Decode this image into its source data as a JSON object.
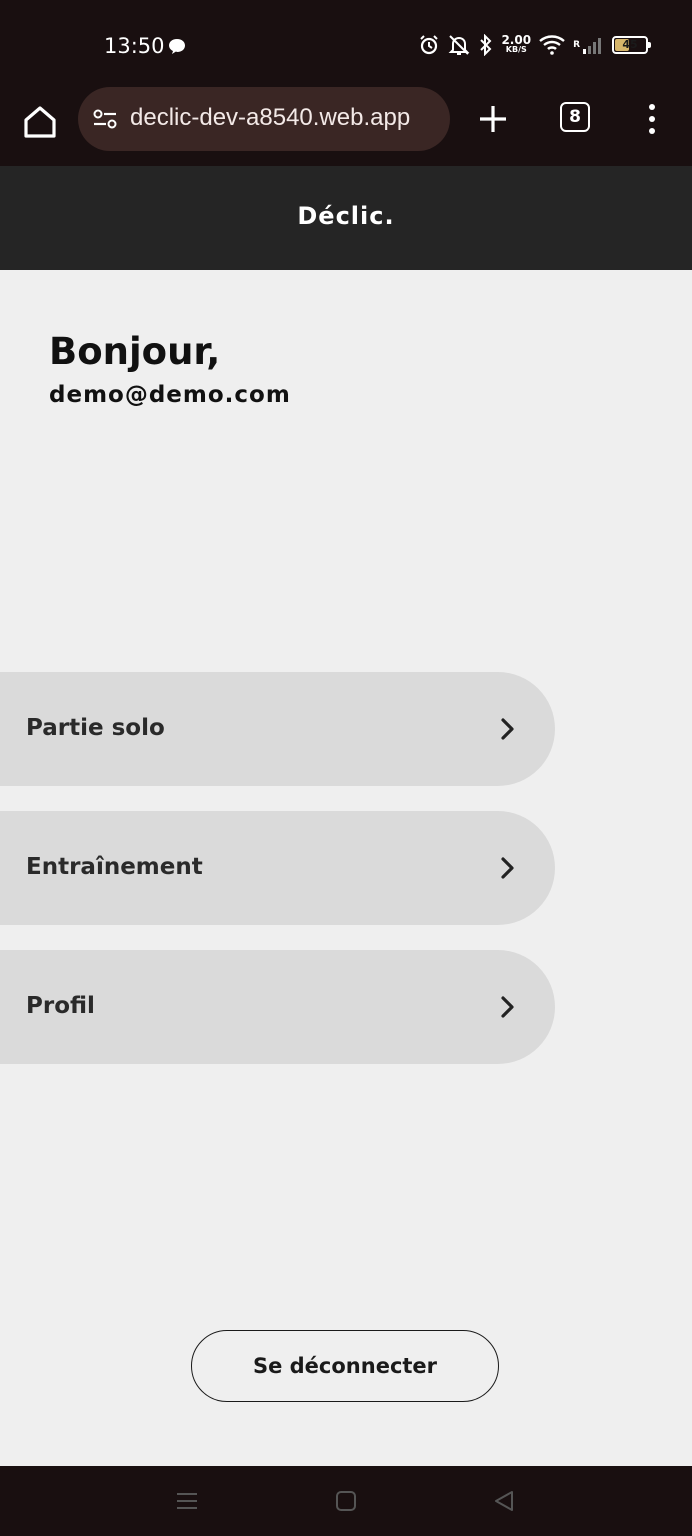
{
  "status_bar": {
    "time": "13:50",
    "network_speed_value": "2.00",
    "network_speed_unit": "KB/S",
    "signal_label": "R",
    "battery_level": "45",
    "icons": [
      "chat-bubble-icon",
      "alarm-icon",
      "silent-bell-icon",
      "bluetooth-icon",
      "wifi-icon",
      "signal-icon",
      "battery-icon"
    ]
  },
  "browser": {
    "url": "declic-dev-a8540.web.app",
    "tab_count": "8",
    "icons": [
      "home-icon",
      "site-settings-icon",
      "plus-icon",
      "tabs-icon",
      "more-vert-icon"
    ]
  },
  "app": {
    "title": "Déclic."
  },
  "main": {
    "greeting": "Bonjour,",
    "email": "demo@demo.com",
    "menu_items": [
      {
        "label": "Partie solo"
      },
      {
        "label": "Entraînement"
      },
      {
        "label": "Profil"
      }
    ],
    "logout_label": "Se déconnecter"
  },
  "nav_bar": {
    "icons": [
      "menu-lines-icon",
      "home-square-icon",
      "back-triangle-icon"
    ]
  },
  "colors": {
    "system_bar": "#190f10",
    "url_box": "#3a2624",
    "app_header": "#252525",
    "page_background": "#efefef",
    "menu_item_background": "#dadada",
    "battery_fill": "#d6b56a"
  }
}
